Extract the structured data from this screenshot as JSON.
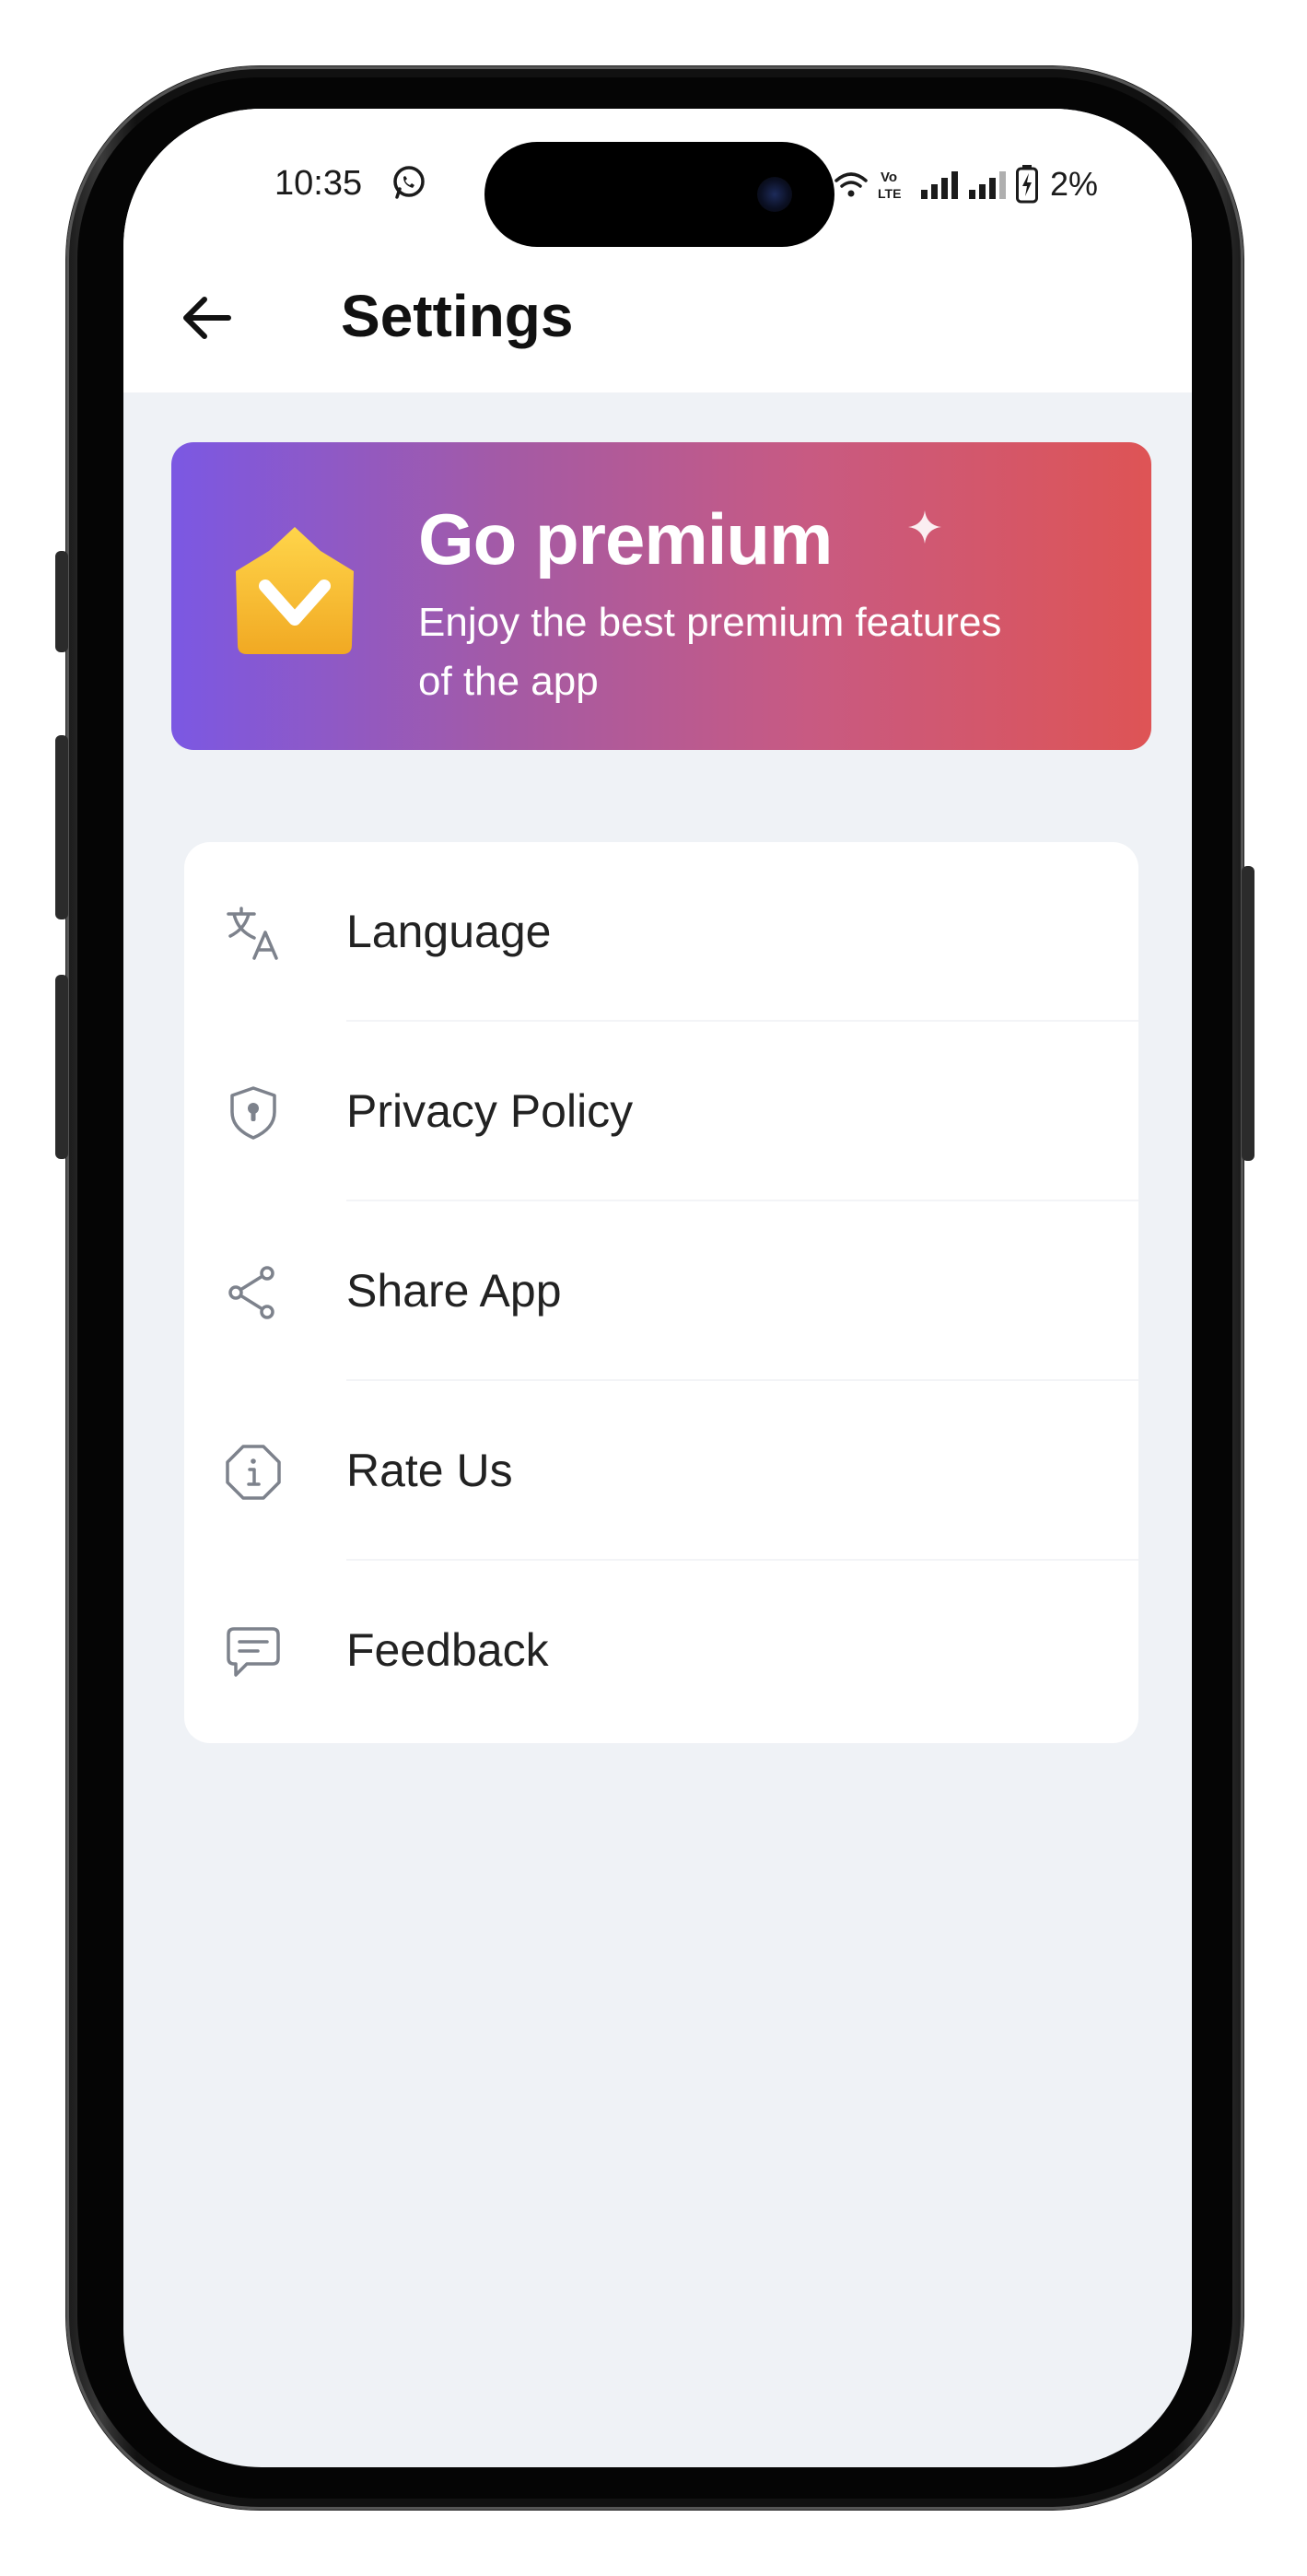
{
  "status_bar": {
    "time": "10:35",
    "battery_percent": "2%",
    "icons": [
      "whatsapp-icon",
      "wifi-icon",
      "volte-icon",
      "signal-icon",
      "signal-icon",
      "battery-charging-icon"
    ]
  },
  "header": {
    "title": "Settings",
    "back_icon": "arrow-left-icon"
  },
  "premium_banner": {
    "title": "Go premium",
    "subtitle": "Enjoy the best premium features of the app",
    "icon": "crown-icon",
    "gradient": [
      "#7b58e3",
      "#de5455"
    ]
  },
  "settings": {
    "items": [
      {
        "label": "Language",
        "icon": "translate-icon"
      },
      {
        "label": "Privacy Policy",
        "icon": "shield-lock-icon"
      },
      {
        "label": "Share App",
        "icon": "share-icon"
      },
      {
        "label": "Rate Us",
        "icon": "info-icon"
      },
      {
        "label": "Feedback",
        "icon": "message-icon"
      }
    ]
  },
  "colors": {
    "background": "#eff2f6",
    "card": "#ffffff",
    "icon_gray": "#7d828c",
    "text": "#222222"
  }
}
